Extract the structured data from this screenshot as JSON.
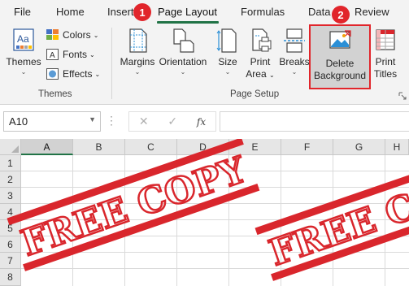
{
  "tabs": [
    {
      "label": "File"
    },
    {
      "label": "Home"
    },
    {
      "label": "Insert"
    },
    {
      "label": "Page Layout",
      "active": true
    },
    {
      "label": "Formulas"
    },
    {
      "label": "Data"
    },
    {
      "label": "Review"
    }
  ],
  "callouts": [
    "1",
    "2"
  ],
  "ribbon": {
    "themes": {
      "themes_label": "Themes",
      "colors_label": "Colors",
      "fonts_label": "Fonts",
      "effects_label": "Effects",
      "group_label": "Themes"
    },
    "page_setup": {
      "margins_label": "Margins",
      "orientation_label": "Orientation",
      "size_label": "Size",
      "print_area_line1": "Print",
      "print_area_line2": "Area",
      "breaks_label": "Breaks",
      "delete_bg_line1": "Delete",
      "delete_bg_line2": "Background",
      "print_titles_line1": "Print",
      "print_titles_line2": "Titles",
      "group_label": "Page Setup"
    }
  },
  "formula_bar": {
    "name_box": "A10",
    "cancel_symbol": "✕",
    "enter_symbol": "✓",
    "fx_label": "fx",
    "formula_value": ""
  },
  "grid": {
    "columns": [
      "A",
      "B",
      "C",
      "D",
      "E",
      "F",
      "G",
      "H"
    ],
    "selected_column": "A",
    "rows": [
      "1",
      "2",
      "3",
      "4",
      "5",
      "6",
      "7",
      "8"
    ],
    "watermark_text": "FREE COPY",
    "watermark_color": "#d9262c"
  },
  "colors": {
    "accent": "#217346",
    "callout": "#e1252b",
    "highlight_border": "#e1252b"
  },
  "icons": [
    "themes-icon",
    "colors-icon",
    "fonts-icon",
    "effects-icon",
    "margins-icon",
    "orientation-icon",
    "size-icon",
    "print-area-icon",
    "breaks-icon",
    "delete-background-icon",
    "print-titles-icon",
    "dialog-launcher-icon"
  ]
}
